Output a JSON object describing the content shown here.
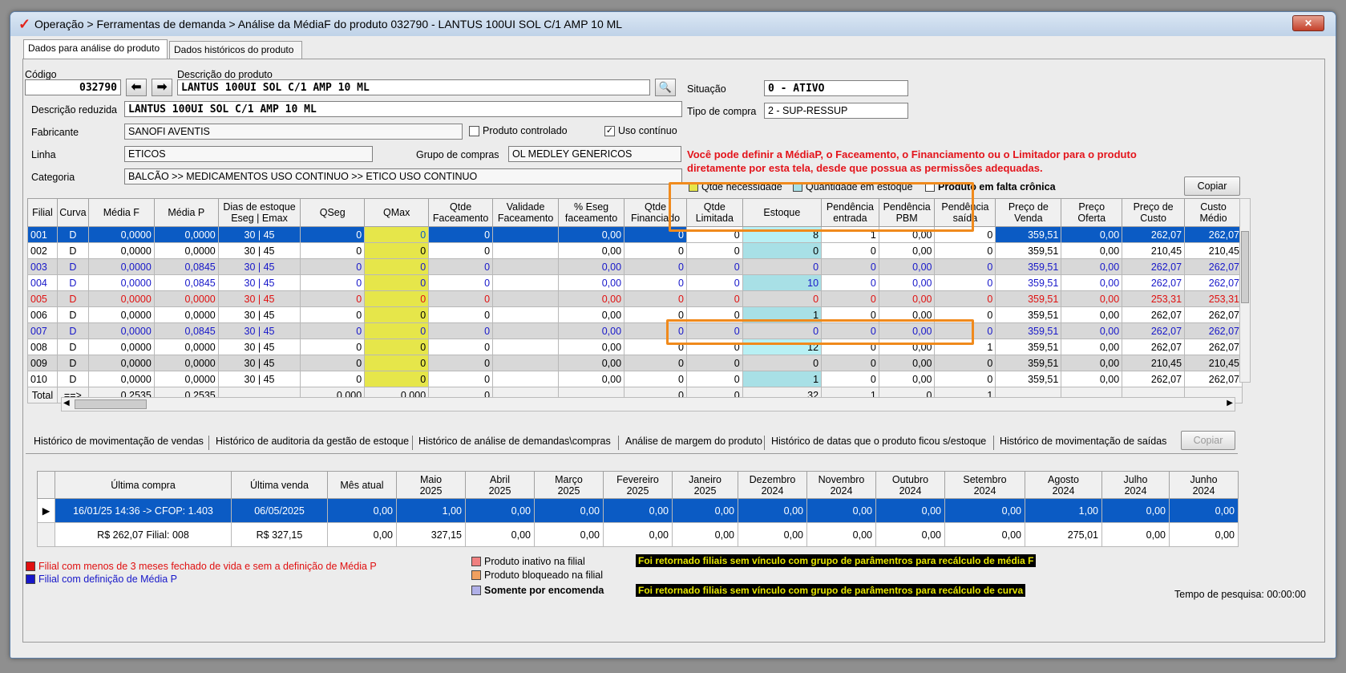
{
  "window": {
    "title": "Operação > Ferramentas de demanda > Análise da MédiaF do produto 032790 - LANTUS 100UI SOL C/1 AMP 10 ML",
    "close": "✕"
  },
  "tabs": [
    "Dados para análise do produto",
    "Dados históricos do produto"
  ],
  "form": {
    "codigo_label": "Código",
    "codigo": "032790",
    "descricao_label": "Descrição do produto",
    "descricao": "LANTUS 100UI SOL C/1 AMP 10 ML",
    "desc_reduzida_label": "Descrição reduzida",
    "desc_reduzida": "LANTUS 100UI SOL C/1 AMP 10 ML",
    "fabricante_label": "Fabricante",
    "fabricante": "SANOFI AVENTIS",
    "linha_label": "Linha",
    "linha": "ETICOS",
    "grupo_label": "Grupo de compras",
    "grupo": "OL MEDLEY GENERICOS",
    "categoria_label": "Categoria",
    "categoria": "BALCÃO >> MEDICAMENTOS USO CONTINUO >> ETICO USO CONTINUO",
    "controlado_label": "Produto controlado",
    "uso_continuo_label": "Uso contínuo",
    "situacao_label": "Situação",
    "situacao": "0 - ATIVO",
    "tipo_compra_label": "Tipo de compra",
    "tipo_compra": "2 - SUP-RESSUP"
  },
  "notice": {
    "line1": "Você pode definir a MédiaP, o Faceamento, o Financiamento ou o Limitador para o produto",
    "line2": "diretamente por esta tela, desde que possua as permissões adequadas."
  },
  "legend_top": {
    "qtde_necessidade": "Qtde necessidade",
    "qtde_estoque": "Quantidade em estoque",
    "falta_cronica": "Produto em falta crônica"
  },
  "copiar": "Copiar",
  "grid": {
    "headers": [
      "Filial",
      "Curva",
      "Média F",
      "Média P",
      "Dias de estoque\nEseg | Emax",
      "QSeg",
      "QMax",
      "Qtde\nFaceamento",
      "Validade\nFaceamento",
      "% Eseg\nfaceamento",
      "Qtde\nFinanciado",
      "Qtde\nLimitada",
      "Estoque",
      "Pendência\nentrada",
      "Pendência\nPBM",
      "Pendência\nsaída",
      "Preço de\nVenda",
      "Preço\nOferta",
      "Preço de\nCusto",
      "Custo\nMédio"
    ],
    "rows": [
      {
        "style": "sel",
        "c": [
          "001",
          "D",
          "0,0000",
          "0,0000",
          "30  |  45",
          "0",
          "0",
          "0",
          "",
          "0,00",
          "0",
          "0",
          "8",
          "1",
          "0,00",
          "0",
          "359,51",
          "0,00",
          "262,07",
          "262,07"
        ]
      },
      {
        "style": "",
        "c": [
          "002",
          "D",
          "0,0000",
          "0,0000",
          "30  |  45",
          "0",
          "0",
          "0",
          "",
          "0,00",
          "0",
          "0",
          "0",
          "0",
          "0,00",
          "0",
          "359,51",
          "0,00",
          "210,45",
          "210,45"
        ]
      },
      {
        "style": "blue alt",
        "c": [
          "003",
          "D",
          "0,0000",
          "0,0845",
          "30  |  45",
          "0",
          "0",
          "0",
          "",
          "0,00",
          "0",
          "0",
          "0",
          "0",
          "0,00",
          "0",
          "359,51",
          "0,00",
          "262,07",
          "262,07"
        ]
      },
      {
        "style": "blue",
        "c": [
          "004",
          "D",
          "0,0000",
          "0,0845",
          "30  |  45",
          "0",
          "0",
          "0",
          "",
          "0,00",
          "0",
          "0",
          "10",
          "0",
          "0,00",
          "0",
          "359,51",
          "0,00",
          "262,07",
          "262,07"
        ]
      },
      {
        "style": "red alt",
        "c": [
          "005",
          "D",
          "0,0000",
          "0,0000",
          "30  |  45",
          "0",
          "0",
          "0",
          "",
          "0,00",
          "0",
          "0",
          "0",
          "0",
          "0,00",
          "0",
          "359,51",
          "0,00",
          "253,31",
          "253,31"
        ]
      },
      {
        "style": "",
        "c": [
          "006",
          "D",
          "0,0000",
          "0,0000",
          "30  |  45",
          "0",
          "0",
          "0",
          "",
          "0,00",
          "0",
          "0",
          "1",
          "0",
          "0,00",
          "0",
          "359,51",
          "0,00",
          "262,07",
          "262,07"
        ]
      },
      {
        "style": "blue alt",
        "c": [
          "007",
          "D",
          "0,0000",
          "0,0845",
          "30  |  45",
          "0",
          "0",
          "0",
          "",
          "0,00",
          "0",
          "0",
          "0",
          "0",
          "0,00",
          "0",
          "359,51",
          "0,00",
          "262,07",
          "262,07"
        ]
      },
      {
        "style": "",
        "c": [
          "008",
          "D",
          "0,0000",
          "0,0000",
          "30  |  45",
          "0",
          "0",
          "0",
          "",
          "0,00",
          "0",
          "0",
          "12",
          "0",
          "0,00",
          "1",
          "359,51",
          "0,00",
          "262,07",
          "262,07"
        ]
      },
      {
        "style": "alt",
        "c": [
          "009",
          "D",
          "0,0000",
          "0,0000",
          "30  |  45",
          "0",
          "0",
          "0",
          "",
          "0,00",
          "0",
          "0",
          "0",
          "0",
          "0,00",
          "0",
          "359,51",
          "0,00",
          "210,45",
          "210,45"
        ]
      },
      {
        "style": "",
        "c": [
          "010",
          "D",
          "0,0000",
          "0,0000",
          "30  |  45",
          "0",
          "0",
          "0",
          "",
          "0,00",
          "0",
          "0",
          "1",
          "0",
          "0,00",
          "0",
          "359,51",
          "0,00",
          "262,07",
          "262,07"
        ]
      }
    ],
    "total": [
      "Total",
      "==>",
      "0,2535",
      "0,2535",
      "",
      "0,000",
      "0,000",
      "0",
      "",
      "",
      "0",
      "0",
      "32",
      "1",
      "0",
      "1",
      "",
      "",
      "",
      ""
    ]
  },
  "hist_tabs": [
    "Histórico de movimentação de vendas",
    "Histórico de auditoria da gestão de estoque",
    "Histórico de análise de demandas\\compras",
    "Análise de margem do produto",
    "Histórico de datas que o produto ficou s/estoque",
    "Histórico de movimentação de saídas"
  ],
  "hist": {
    "headers": [
      "",
      "Última compra",
      "Última venda",
      "Mês atual",
      "Maio\n2025",
      "Abril\n2025",
      "Março\n2025",
      "Fevereiro\n2025",
      "Janeiro\n2025",
      "Dezembro\n2024",
      "Novembro\n2024",
      "Outubro\n2024",
      "Setembro\n2024",
      "Agosto\n2024",
      "Julho\n2024",
      "Junho\n2024"
    ],
    "rows": [
      {
        "style": "sel",
        "c": [
          "▶",
          "16/01/25 14:36 -> CFOP: 1.403",
          "06/05/2025",
          "0,00",
          "1,00",
          "0,00",
          "0,00",
          "0,00",
          "0,00",
          "0,00",
          "0,00",
          "0,00",
          "0,00",
          "1,00",
          "0,00",
          "0,00"
        ]
      },
      {
        "style": "",
        "c": [
          "",
          "R$ 262,07 Filial: 008",
          "R$ 327,15",
          "0,00",
          "327,15",
          "0,00",
          "0,00",
          "0,00",
          "0,00",
          "0,00",
          "0,00",
          "0,00",
          "0,00",
          "275,01",
          "0,00",
          "0,00"
        ]
      }
    ]
  },
  "bottom_legend": {
    "red_filial": "Filial com menos de 3 meses fechado de vida e sem a definição de Média P",
    "blue_filial": "Filial com definição de Média P",
    "inativo": "Produto inativo na filial",
    "bloqueado": "Produto bloqueado na filial",
    "encomenda": "Somente por encomenda",
    "msg1": "Foi retornado filiais sem vínculo com grupo de parâmentros para recálculo de média F",
    "msg2": "Foi retornado filiais sem vínculo com grupo de parâmentros para recálculo de curva",
    "tempo": "Tempo de pesquisa: 00:00:00"
  },
  "colors": {
    "selected": "#0b5bc4",
    "highlight": "#f08a1c",
    "yellow": "#e6e64a",
    "cyan": "#a8e0e6"
  }
}
